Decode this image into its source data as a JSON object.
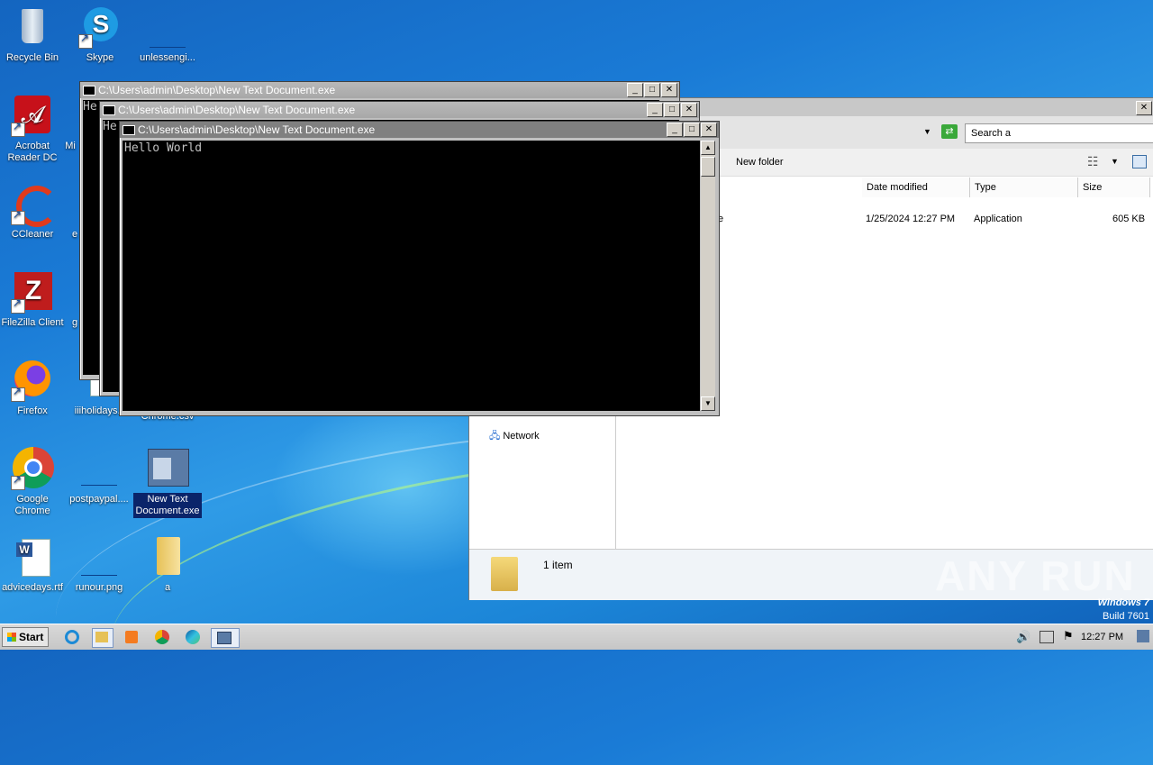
{
  "desktop": {
    "icons": [
      {
        "label": "Recycle Bin"
      },
      {
        "label": "Skype"
      },
      {
        "label": "unlessengi..."
      },
      {
        "label": "Acrobat Reader DC"
      },
      {
        "label": "Mi"
      },
      {
        "label": "CCleaner"
      },
      {
        "label": "e"
      },
      {
        "label": "FileZilla Client"
      },
      {
        "label": "g"
      },
      {
        "label": "Firefox"
      },
      {
        "label": "iiiholidays.r"
      },
      {
        "label": "Chrome.csv"
      },
      {
        "label": "Google Chrome"
      },
      {
        "label": "postpaypal...."
      },
      {
        "label": "New Text Document.exe"
      },
      {
        "label": "advicedays.rtf"
      },
      {
        "label": "runour.png"
      },
      {
        "label": "a"
      }
    ]
  },
  "consoles": [
    {
      "title": "C:\\Users\\admin\\Desktop\\New Text Document.exe",
      "text": "He"
    },
    {
      "title": "C:\\Users\\admin\\Desktop\\New Text Document.exe",
      "text": "He"
    },
    {
      "title": "C:\\Users\\admin\\Desktop\\New Text Document.exe",
      "text": "Hello World"
    }
  ],
  "window_buttons": {
    "min": "_",
    "max": "□",
    "close": "✕"
  },
  "explorer": {
    "search_placeholder": "Search a",
    "new_folder": "New folder",
    "columns": {
      "date": "Date modified",
      "type": "Type",
      "size": "Size"
    },
    "row": {
      "name": "e",
      "date": "1/25/2024 12:27 PM",
      "type": "Application",
      "size": "605 KB"
    },
    "nav_network": "Network",
    "status": "1 item"
  },
  "taskbar": {
    "start": "Start",
    "clock": "12:27 PM"
  },
  "branding": {
    "line1": "Windows 7",
    "line2": "Build 7601"
  },
  "watermark": "ANY RUN"
}
